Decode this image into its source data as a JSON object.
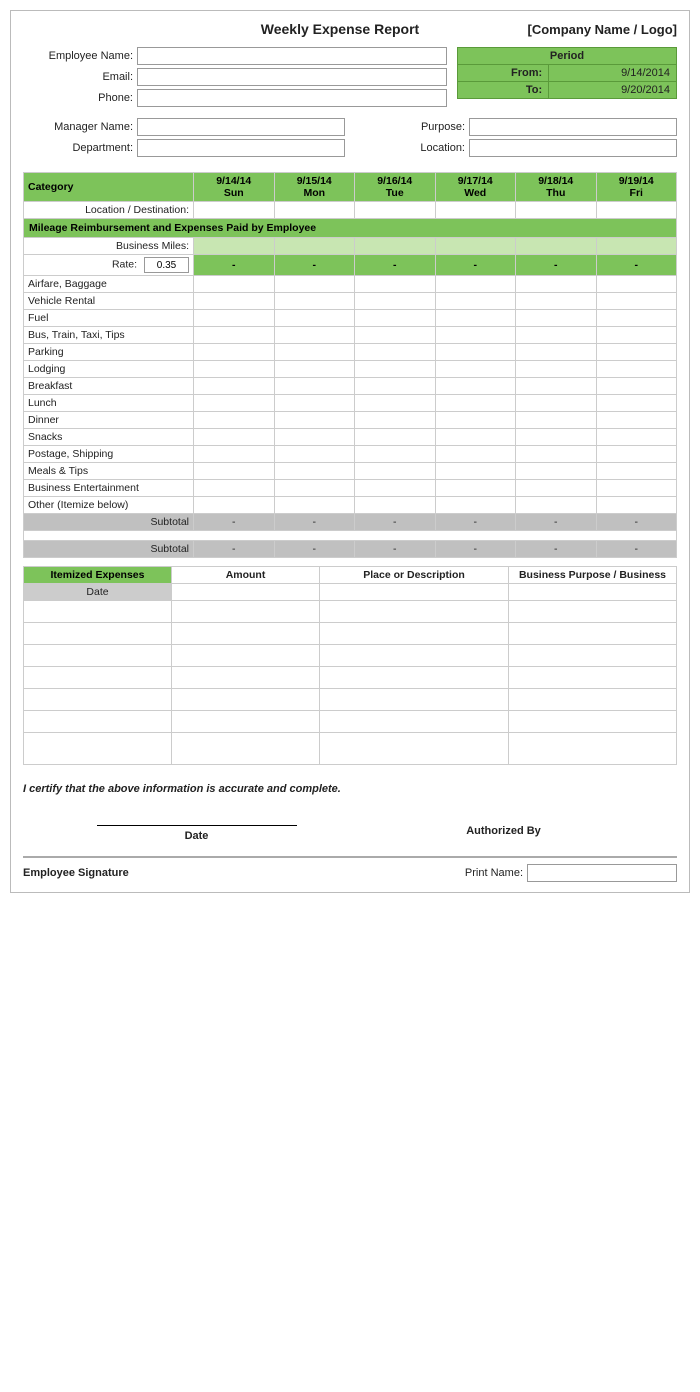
{
  "title": "Weekly Expense Report",
  "company": "[Company Name / Logo]",
  "fields": {
    "employee_name_label": "Employee Name:",
    "email_label": "Email:",
    "phone_label": "Phone:",
    "manager_name_label": "Manager Name:",
    "department_label": "Department:",
    "purpose_label": "Purpose:",
    "location_label": "Location:"
  },
  "period": {
    "header": "Period",
    "from_label": "From:",
    "from_value": "9/14/2014",
    "to_label": "To:",
    "to_value": "9/20/2014"
  },
  "days": {
    "dates": [
      "9/14/14",
      "9/15/14",
      "9/16/14",
      "9/17/14",
      "9/18/14",
      "9/19/14"
    ],
    "names": [
      "Sun",
      "Mon",
      "Tue",
      "Wed",
      "Thu",
      "Fri"
    ]
  },
  "category_label": "Category",
  "location_destination": "Location / Destination:",
  "mileage_section": "Mileage Reimbursement and Expenses Paid by Employee",
  "business_miles_label": "Business Miles:",
  "rate_label": "Rate:",
  "rate_value": "0.35",
  "categories": [
    "Airfare, Baggage",
    "Vehicle Rental",
    "Fuel",
    "Bus, Train, Taxi, Tips",
    "Parking",
    "Lodging",
    "Breakfast",
    "Lunch",
    "Dinner",
    "Snacks",
    "Postage, Shipping",
    "Meals & Tips",
    "Business Entertainment",
    "Other (Itemize below)"
  ],
  "subtotal_label": "Subtotal",
  "dash": "-",
  "itemized": {
    "header": "Itemized Expenses",
    "amount_col": "Amount",
    "place_col": "Place or Description",
    "business_col": "Business Purpose / Business",
    "date_col": "Date",
    "rows": 7
  },
  "certify_text": "I certify that the above information is accurate and complete.",
  "date_label": "Date",
  "authorized_by_label": "Authorized By",
  "employee_signature_label": "Employee Signature",
  "print_name_label": "Print Name:"
}
